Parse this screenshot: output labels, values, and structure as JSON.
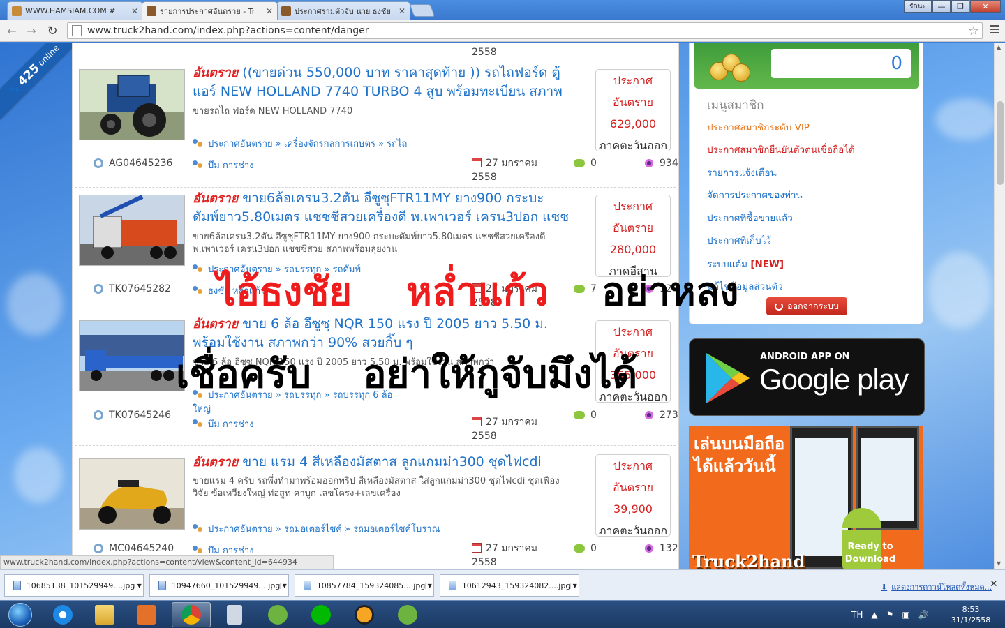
{
  "tabs": [
    {
      "title": "WWW.HAMSIAM.COM #",
      "color": "#c98a3a"
    },
    {
      "title": "รายการประกาศอันตราย - Tr",
      "color": "#8a5a2a"
    },
    {
      "title": "ประกาศรามตัวจับ นาย ธงชัย",
      "color": "#8a5a2a"
    }
  ],
  "window": {
    "user_label": "รักนะ",
    "minimize": "—",
    "maximize": "❐",
    "close": "✕"
  },
  "address": {
    "url": "www.truck2hand.com/index.php?actions=content/danger"
  },
  "online": {
    "count": "425",
    "label": "online"
  },
  "top_partial_year": "2558",
  "listings": [
    {
      "tag": "อันตราย",
      "title": "((ขายด่วน 550,000 บาท ราคาสุดท้าย )) รถไถฟอร์ด ตู้แอร์ NEW HOLLAND 7740 TURBO 4 สูบ พร้อมทะเบียน สภาพ",
      "desc": "ขายรถไถ ฟอร์ด NEW HOLLAND 7740",
      "breadcrumb": "ประกาศอันตราย » เครื่องจักรกลการเกษตร » รถไถ",
      "code": "AG04645236",
      "poster": "บึม การช่าง",
      "date": "27 มกราคม",
      "year": "2558",
      "comments": "0",
      "views": "934",
      "price_label": "ประกาศ",
      "price_tag": "อันตราย",
      "price": "629,000",
      "region": "ภาคตะวันออก"
    },
    {
      "tag": "อันตราย",
      "title": "ขาย6ล้อเครน3.2ตัน อีซูซุFTR11MY ยาง900 กระบะดัมพ์ยาว5.80เมตร แชชซีสวยเครื่องดี พ.เพาเวอร์ เครน3ปอก แชช",
      "desc": "ขาย6ล้อเครน3.2ตัน อีซูซุFTR11MY ยาง900 กระบะดัมพ์ยาว5.80เมตร แชชซีสวยเครื่องดี พ.เพาเวอร์ เครน3ปอก แชชซีสวย สภาพพร้อมลุยงาน",
      "breadcrumb": "ประกาศอันตราย » รถบรรทุก » รถดัมพ์",
      "code": "TK07645282",
      "poster": "ธงชัย หล่ำแก้ว",
      "date": "27 มกราคม",
      "year": "2558",
      "comments": "7",
      "views": "12",
      "price_label": "ประกาศ",
      "price_tag": "อันตราย",
      "price": "280,000",
      "region": "ภาคอีสาน"
    },
    {
      "tag": "อันตราย",
      "title": "ขาย 6 ล้อ อีซูซุ NQR 150 แรง ปี 2005 ยาว 5.50 ม. พร้อมใช้งาน สภาพกว่า 90% สวยกิ๊บ ๆ",
      "desc": "ขาย 6 ล้อ อีซูซุ NQR 150 แรง ปี 2005 ยาว 5.50 ม. พร้อมใช้งาน สภาพกว่า",
      "breadcrumb": "ประกาศอันตราย » รถบรรทุก » รถบรรทุก 6 ล้อ",
      "breadcrumb_extra": "ใหญ่",
      "code": "TK07645246",
      "poster": "บึม การช่าง",
      "date": "27 มกราคม",
      "year": "2558",
      "comments": "0",
      "views": "273",
      "price_label": "ประกาศ",
      "price_tag": "อันตราย",
      "price": "355,000",
      "region": "ภาคตะวันออก"
    },
    {
      "tag": "อันตราย",
      "title": "ขาย แรม 4 สีเหลืองมัสตาส ลูกแกมม่า300 ชุดไฟcdi",
      "desc": "ขายแรม 4 ครับ รถพึ่งทำมาพร้อมออกทริป สีเหลืองมัสตาส ใส่ลูกแกมม่า300 ชุดไฟcdi ชุดเฟืองวิจัย ข้อเหวียงใหญ่ ท่อสูท คาบูก เลขโครง+เลขเครื่อง",
      "breadcrumb": "ประกาศอันตราย » รถมอเตอร์ไซค์ » รถมอเตอร์ไซค์โบราณ",
      "code": "MC04645240",
      "poster": "บึม การช่าง",
      "date": "27 มกราคม",
      "year": "2558",
      "comments": "0",
      "views": "132",
      "price_label": "ประกาศ",
      "price_tag": "อันตราย",
      "price": "39,900",
      "region": "ภาคตะวันออก"
    }
  ],
  "sidebar": {
    "credit": "0",
    "menu_title": "เมนูสมาชิก",
    "items": [
      {
        "label": "ประกาศสมาชิกระดับ VIP"
      },
      {
        "label": "ประกาศสมาชิกยืนยันตัวตนเชื่อถือได้"
      },
      {
        "label": "รายการแจ้งเตือน"
      },
      {
        "label": "จัดการประกาศของท่าน"
      },
      {
        "label": "ประกาศที่ซื้อขายแล้ว"
      },
      {
        "label": "ประกาศที่เก็บไว้"
      },
      {
        "label": "ระบบแต้ม",
        "badge": "[NEW]"
      },
      {
        "label": "แก้ไขข้อมูลส่วนตัว"
      }
    ],
    "logout": "ออกจากระบบ"
  },
  "gplay": {
    "sub": "ANDROID APP ON",
    "big": "Google play"
  },
  "promo": {
    "line1": "เล่นบนมือถือ",
    "line2": "ได้แล้ววันนี้",
    "logo": "Truck2hand",
    "ready1": "Ready to",
    "ready2": "Download"
  },
  "overlay": {
    "line1_a": "ไอ้ธงชัย",
    "line1_b": "หล่ำแก้ว",
    "line1_c": "อย่าหลง",
    "line2_a": "เชื่อครับ",
    "line2_b": "อย่าให้กูจับมึงได้"
  },
  "status_url": "www.truck2hand.com/index.php?actions=content/view&content_id=644934",
  "downloads": [
    {
      "name": "10685138_101529949....jpg"
    },
    {
      "name": "10947660_101529949....jpg"
    },
    {
      "name": "10857784_159324085....jpg"
    },
    {
      "name": "10612943_159324082....jpg"
    }
  ],
  "show_all": "แสดงการดาวน์โหลดทั้งหมด...",
  "taskbar": {
    "lang": "TH",
    "time": "8:53",
    "date": "31/1/2558"
  }
}
